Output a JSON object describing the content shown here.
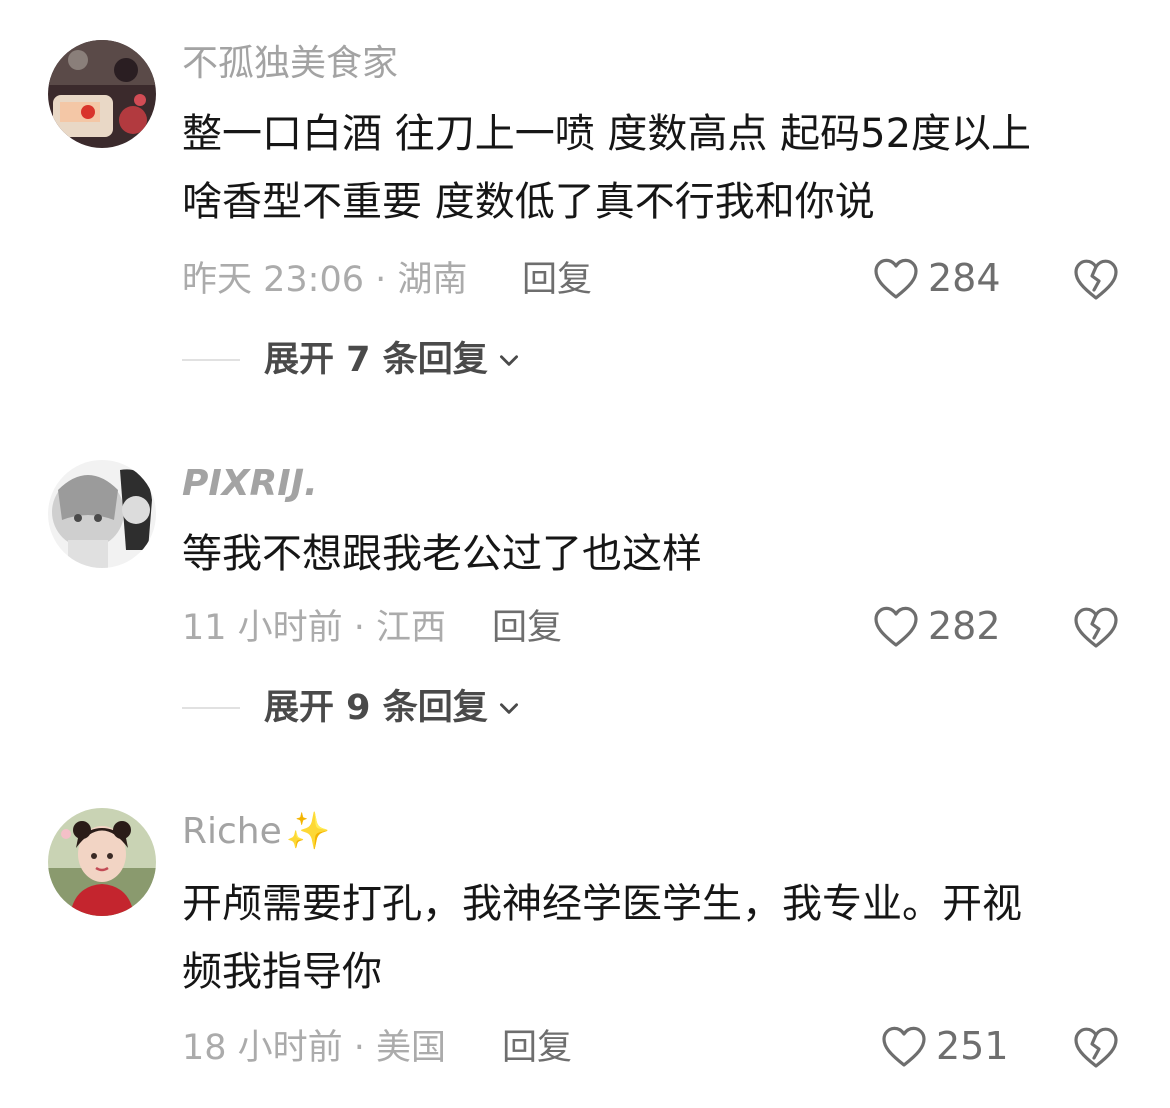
{
  "comments": [
    {
      "username": "不孤独美食家",
      "text_lines": [
        "整一口白酒 往刀上一喷  度数高点 起码52度以上",
        "啥香型不重要  度数低了真不行我和你说"
      ],
      "meta": "昨天 23:06 · 湖南",
      "reply_label": "回复",
      "likes": "284",
      "expand_label": "展开 7 条回复"
    },
    {
      "username": "PIXRIJ.",
      "text_lines": [
        "等我不想跟我老公过了也这样"
      ],
      "meta": "11 小时前 · 江西",
      "reply_label": "回复",
      "likes": "282",
      "expand_label": "展开 9 条回复"
    },
    {
      "username": "Riche",
      "username_emoji": "✨",
      "text_lines": [
        "开颅需要打孔，我神经学医学生，我专业。开视",
        "频我指导你"
      ],
      "meta": "18 小时前 · 美国",
      "reply_label": "回复",
      "likes": "251"
    }
  ],
  "icons": {
    "like": "heart-outline-icon",
    "dislike": "broken-heart-icon",
    "expand": "chevron-down-icon"
  },
  "colors": {
    "text": "#161616",
    "secondary": "#a3a3a3",
    "action": "#6e6e6e"
  }
}
